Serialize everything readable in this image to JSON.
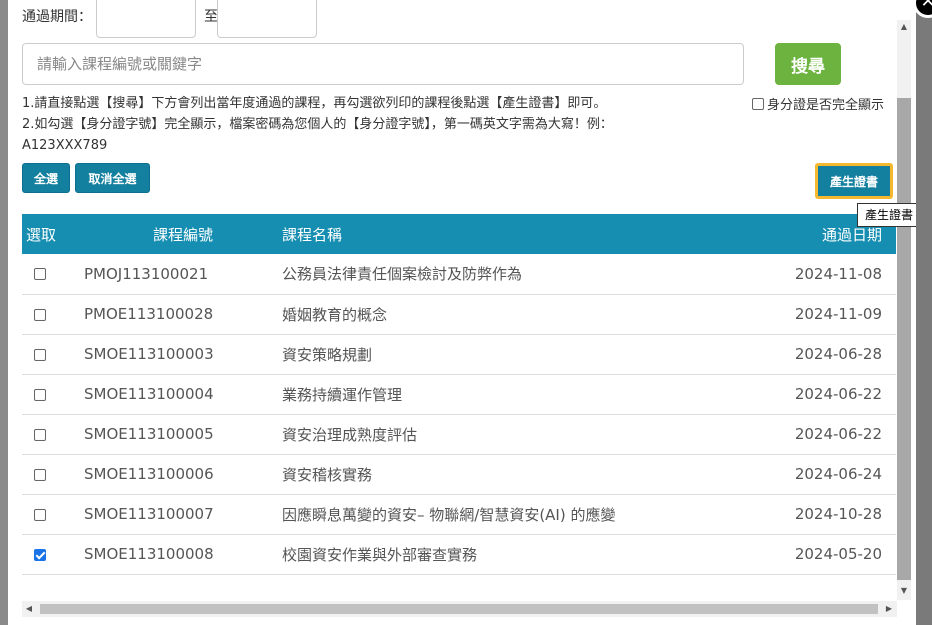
{
  "search": {
    "date_label": "通過期間：",
    "date_separator": "至",
    "placeholder": "請輸入課程編號或關鍵字",
    "button_label": "搜尋",
    "show_id_label": "身分證是否完全顯示"
  },
  "instructions": {
    "line1": "1.請直接點選【搜尋】下方會列出當年度通過的課程，再勾選欲列印的課程後點選【產生證書】即可。",
    "line2": "2.如勾選【身分證字號】完全顯示，檔案密碼為您個人的【身分證字號】，第一碼英文字需為大寫！例：",
    "line3": "A123XXX789"
  },
  "buttons": {
    "select_all": "全選",
    "deselect_all": "取消全選",
    "generate": "產生證書",
    "generate_tooltip": "產生證書",
    "close": "✕"
  },
  "table": {
    "headers": [
      "選取",
      "課程編號",
      "課程名稱",
      "通過日期"
    ],
    "rows": [
      {
        "checked": false,
        "code": "PMOJ113100021",
        "name": "公務員法律責任個案檢討及防弊作為",
        "date": "2024-11-08"
      },
      {
        "checked": false,
        "code": "PMOE113100028",
        "name": "婚姻教育的概念",
        "date": "2024-11-09"
      },
      {
        "checked": false,
        "code": "SMOE113100003",
        "name": "資安策略規劃",
        "date": "2024-06-28"
      },
      {
        "checked": false,
        "code": "SMOE113100004",
        "name": "業務持續運作管理",
        "date": "2024-06-22"
      },
      {
        "checked": false,
        "code": "SMOE113100005",
        "name": "資安治理成熟度評估",
        "date": "2024-06-22"
      },
      {
        "checked": false,
        "code": "SMOE113100006",
        "name": "資安稽核實務",
        "date": "2024-06-24"
      },
      {
        "checked": false,
        "code": "SMOE113100007",
        "name": "因應瞬息萬變的資安– 物聯網/智慧資安(AI) 的應變",
        "date": "2024-10-28"
      },
      {
        "checked": true,
        "code": "SMOE113100008",
        "name": "校園資安作業與外部審查實務",
        "date": "2024-05-20"
      }
    ]
  }
}
